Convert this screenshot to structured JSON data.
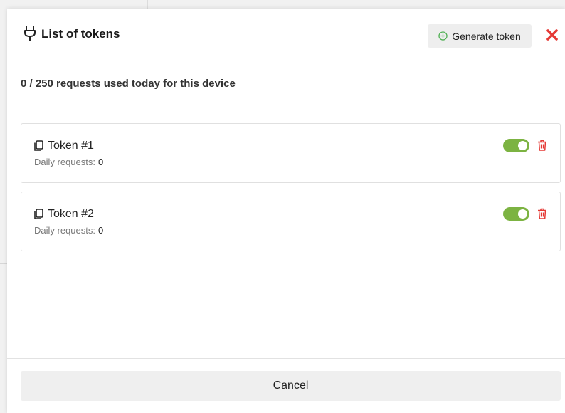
{
  "modal": {
    "title": "List of tokens",
    "title_icon": "plug-icon",
    "generate_button": {
      "label": "Generate token",
      "icon": "plus-circle-icon"
    },
    "close_icon": "close-icon",
    "usage_text": "0 / 250 requests used today for this device",
    "tokens": [
      {
        "name": "Token #1",
        "daily_label": "Daily requests:",
        "daily_count": "0",
        "enabled": true
      },
      {
        "name": "Token #2",
        "daily_label": "Daily requests:",
        "daily_count": "0",
        "enabled": true
      }
    ],
    "cancel_label": "Cancel"
  },
  "colors": {
    "toggle_on": "#7cb342",
    "danger": "#e53935",
    "accent_green": "#4caf50"
  }
}
